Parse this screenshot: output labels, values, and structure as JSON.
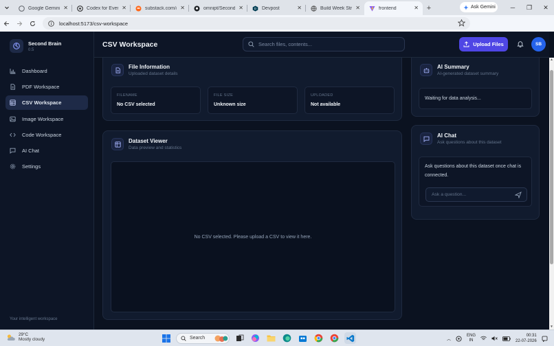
{
  "browser": {
    "tabs": [
      {
        "label": "Google Gemini S",
        "favicon": "gemini-icon",
        "active": false
      },
      {
        "label": "Codex for Everyo",
        "favicon": "openai-icon",
        "active": false
      },
      {
        "label": "substack.com/@",
        "favicon": "substack-icon",
        "active": false
      },
      {
        "label": "omnipt/SecondB",
        "favicon": "github-icon",
        "active": false
      },
      {
        "label": "Devpost",
        "favicon": "devpost-icon",
        "active": false
      },
      {
        "label": "Build Week Strat",
        "favicon": "globe-icon",
        "active": false
      },
      {
        "label": "frontend",
        "favicon": "vite-icon",
        "active": true
      }
    ],
    "ask_gemini": "Ask Gemini",
    "url": "localhost:5173/csv-workspace"
  },
  "sidebar": {
    "brand_name": "Second Brain",
    "brand_version": "0.5",
    "items": [
      {
        "label": "Dashboard",
        "icon": "bar-chart-icon",
        "active": false
      },
      {
        "label": "PDF Workspace",
        "icon": "document-icon",
        "active": false
      },
      {
        "label": "CSV Workspace",
        "icon": "table-icon",
        "active": true
      },
      {
        "label": "Image Workspace",
        "icon": "image-icon",
        "active": false
      },
      {
        "label": "Code Workspace",
        "icon": "code-icon",
        "active": false
      },
      {
        "label": "AI Chat",
        "icon": "chat-icon",
        "active": false
      },
      {
        "label": "Settings",
        "icon": "gear-icon",
        "active": false
      }
    ],
    "footer": "Your intelligent workspace"
  },
  "header": {
    "title": "CSV Workspace",
    "search_placeholder": "Search files, contents...",
    "upload_label": "Upload Files",
    "avatar_initials": "SB"
  },
  "file_info": {
    "title": "File Information",
    "subtitle": "Uploaded dataset details",
    "fields": [
      {
        "label": "FILENAME",
        "value": "No CSV selected"
      },
      {
        "label": "FILE SIZE",
        "value": "Unknown size"
      },
      {
        "label": "UPLOADED",
        "value": "Not available"
      }
    ]
  },
  "ai_summary": {
    "title": "AI Summary",
    "subtitle": "AI-generated dataset summary",
    "status": "Waiting for data analysis..."
  },
  "dataset_viewer": {
    "title": "Dataset Viewer",
    "subtitle": "Data preview and statistics",
    "empty_message": "No CSV selected. Please upload a CSV to view it here."
  },
  "ai_chat": {
    "title": "AI Chat",
    "subtitle": "Ask questions about this dataset",
    "message": "Ask questions about this dataset once chat is connected.",
    "input_placeholder": "Ask a question..."
  },
  "taskbar": {
    "weather_temp": "29°C",
    "weather_desc": "Mostly cloudy",
    "search_label": "Search",
    "lang_1": "ENG",
    "lang_2": "IN",
    "time": "00:31",
    "date": "22-07-2026"
  },
  "colors": {
    "accent": "#4f46e5",
    "avatar": "#2563eb",
    "background": "#0b1220",
    "card": "#111b2e"
  }
}
